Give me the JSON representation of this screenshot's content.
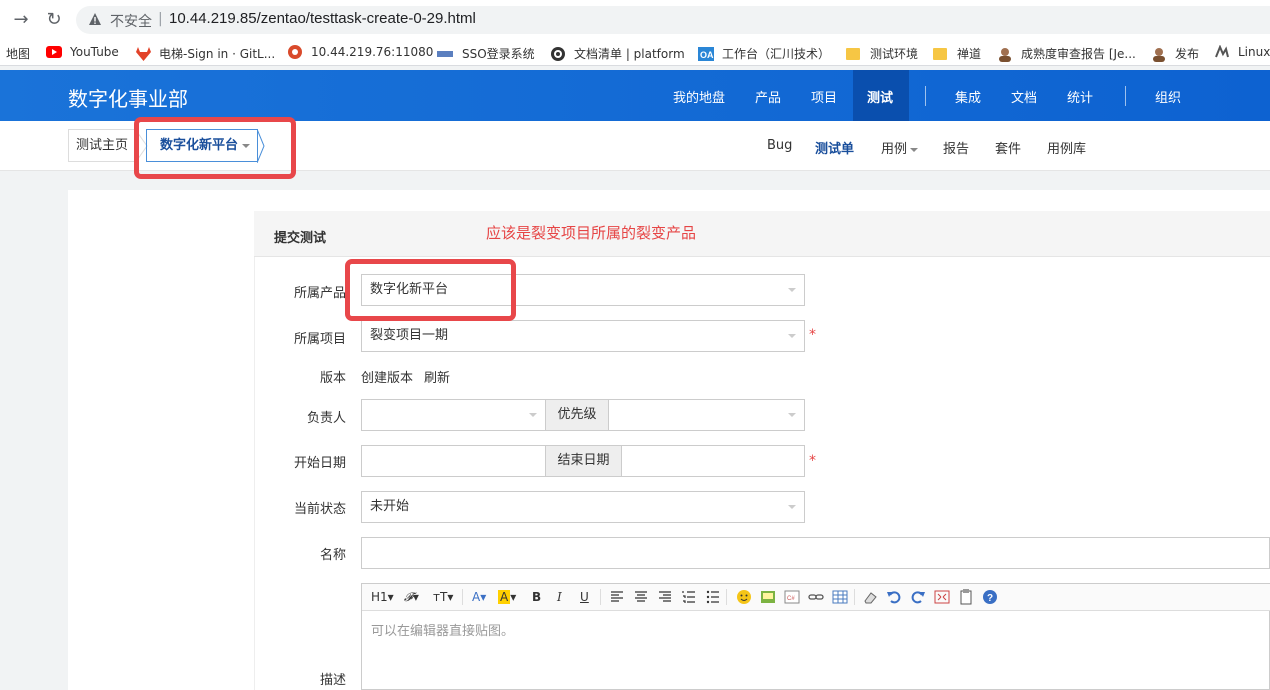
{
  "browser": {
    "url_insecure": "不安全",
    "url_sep": "|",
    "url": "10.44.219.85/zentao/testtask-create-0-29.html"
  },
  "bookmarks": [
    {
      "label": "地图",
      "icon": "map-icon",
      "color": ""
    },
    {
      "label": "YouTube",
      "icon": "youtube-icon",
      "color": "#ff0000"
    },
    {
      "label": "电梯-Sign in · GitL...",
      "icon": "gitlab-icon",
      "color": "#e24329"
    },
    {
      "label": "10.44.219.76:11080",
      "icon": "site-icon",
      "color": "#d94a2b"
    },
    {
      "label": "SSO登录系统",
      "icon": "sso-icon",
      "color": "#5b7fbf"
    },
    {
      "label": "文档清单 | platform",
      "icon": "github-icon",
      "color": "#333333"
    },
    {
      "label": "工作台（汇川技术）",
      "icon": "oa-icon",
      "color": "#2a86d6"
    },
    {
      "label": "测试环境",
      "icon": "folder-icon",
      "color": "#f6c644"
    },
    {
      "label": "禅道",
      "icon": "folder-icon",
      "color": "#f6c644"
    },
    {
      "label": "成熟度审查报告 [Je...",
      "icon": "avatar-icon",
      "color": "#a07050"
    },
    {
      "label": "发布",
      "icon": "avatar-icon",
      "color": "#a07050"
    },
    {
      "label": "Linux",
      "icon": "linux-icon",
      "color": "#555555"
    }
  ],
  "header": {
    "brand": "数字化事业部",
    "nav": [
      "我的地盘",
      "产品",
      "项目",
      "测试",
      "集成",
      "文档",
      "统计",
      "组织"
    ],
    "active": "测试",
    "color": "#1a73d9"
  },
  "subheader": {
    "home": "测试主页",
    "product": "数字化新平台",
    "nav": [
      "Bug",
      "测试单",
      "用例",
      "报告",
      "套件",
      "用例库"
    ],
    "active": "测试单"
  },
  "form": {
    "title": "提交测试",
    "annotation": "应该是裂变项目所属的裂变产品",
    "labels": {
      "product": "所属产品",
      "project": "所属项目",
      "build": "版本",
      "owner": "负责人",
      "priority": "优先级",
      "begin": "开始日期",
      "end": "结束日期",
      "status": "当前状态",
      "name": "名称",
      "desc": "描述"
    },
    "values": {
      "product": "数字化新平台",
      "project": "裂变项目一期",
      "owner": "",
      "priority": "",
      "status": "未开始"
    },
    "build_links": [
      "创建版本",
      "刷新"
    ],
    "required_mark": "*",
    "editor_placeholder": "可以在编辑器直接贴图。",
    "toolbar": {
      "h1": "H1",
      "font": "𝓕",
      "size": "тT",
      "a_color": "A",
      "a_bg": "A",
      "bold": "B",
      "italic": "I",
      "underline": "U"
    }
  },
  "highlight_color": "#e8474a"
}
